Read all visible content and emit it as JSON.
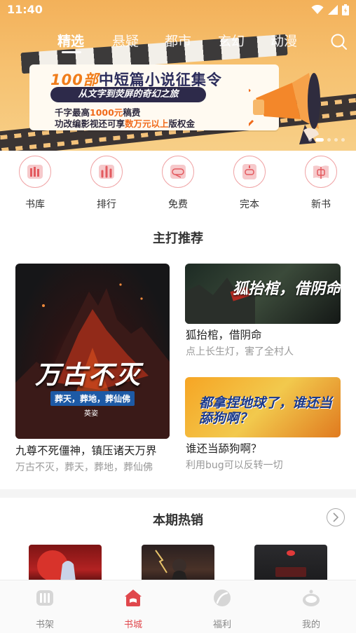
{
  "status": {
    "time": "11:40"
  },
  "tabs": [
    {
      "label": "精选",
      "active": true
    },
    {
      "label": "悬疑",
      "active": false
    },
    {
      "label": "都市",
      "active": false
    },
    {
      "label": "玄幻",
      "active": false
    },
    {
      "label": "动漫",
      "active": false
    }
  ],
  "banner": {
    "title_num": "100部",
    "title_rest": "中短篇小说征集令",
    "subtitle": "从文字到荧屏的奇幻之旅",
    "line1_pre": "千字最高",
    "line1_hl": "1000元",
    "line1_post": "稿费",
    "line2_pre": "功改编影视还可享",
    "line2_hl": "数万元以上",
    "line2_post": "版权金",
    "slide_count": 5,
    "active_slide": 1
  },
  "quick_nav": [
    {
      "label": "书库",
      "icon": "library-icon"
    },
    {
      "label": "排行",
      "icon": "ranking-icon"
    },
    {
      "label": "免费",
      "icon": "free-icon"
    },
    {
      "label": "完本",
      "icon": "completed-icon"
    },
    {
      "label": "新书",
      "icon": "new-book-icon"
    }
  ],
  "featured": {
    "section_title": "主打推荐",
    "big": {
      "cover_title": "万古不灭",
      "cover_subtitle": "葬天，葬地，葬仙佛",
      "cover_author": "英姿",
      "title": "九尊不死僵神，镇压诸天万界",
      "desc": "万古不灭，葬天，葬地，葬仙佛"
    },
    "small": [
      {
        "cover_title": "狐抬棺，借阴命",
        "title": "狐抬棺，借阴命",
        "desc": "点上长生灯，害了全村人"
      },
      {
        "cover_title": "都拿捏地球了，谁还当舔狗啊？",
        "title": "谁还当舔狗啊？",
        "desc": "利用bug可以反转一切"
      }
    ]
  },
  "hot": {
    "section_title": "本期热销"
  },
  "bottom_nav": [
    {
      "label": "书架",
      "icon": "bookshelf-icon",
      "active": false
    },
    {
      "label": "书城",
      "icon": "bookstore-icon",
      "active": true
    },
    {
      "label": "福利",
      "icon": "welfare-icon",
      "active": false
    },
    {
      "label": "我的",
      "icon": "profile-icon",
      "active": false
    }
  ]
}
